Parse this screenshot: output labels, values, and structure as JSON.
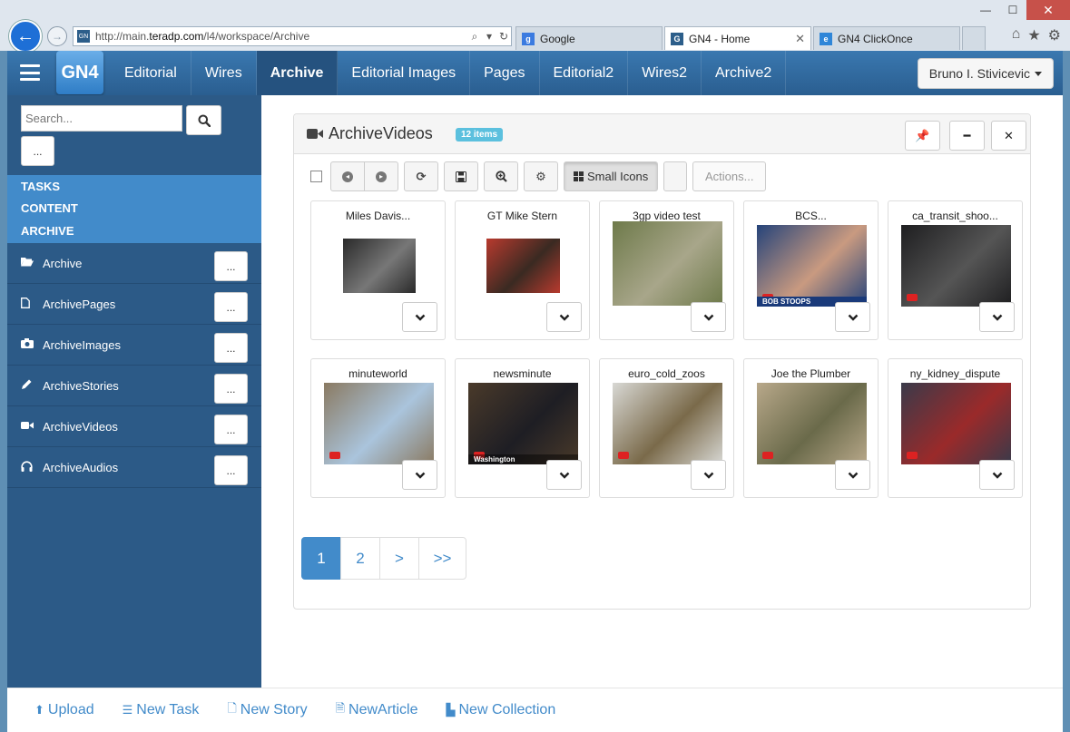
{
  "browser": {
    "url_prefix": "http://main.",
    "url_domain": "teradp.com",
    "url_suffix": "/l4/workspace/Archive",
    "tabs": [
      {
        "label": "Google",
        "active": false
      },
      {
        "label": "GN4 - Home",
        "active": true
      },
      {
        "label": "GN4 ClickOnce",
        "active": false
      }
    ],
    "win": {
      "minimize": "—",
      "maximize": "☐",
      "close": "✕"
    }
  },
  "header": {
    "logo": "GN4",
    "nav": [
      "Editorial",
      "Wires",
      "Archive",
      "Editorial Images",
      "Pages",
      "Editorial2",
      "Wires2",
      "Archive2"
    ],
    "active_nav": "Archive",
    "user": "Bruno I. Stivicevic"
  },
  "sidebar": {
    "search_placeholder": "Search...",
    "more_label": "...",
    "sections": [
      "TASKS",
      "CONTENT",
      "ARCHIVE"
    ],
    "items": [
      {
        "label": "Archive",
        "icon": "folder-open-icon"
      },
      {
        "label": "ArchivePages",
        "icon": "file-icon"
      },
      {
        "label": "ArchiveImages",
        "icon": "camera-icon"
      },
      {
        "label": "ArchiveStories",
        "icon": "pencil-icon"
      },
      {
        "label": "ArchiveVideos",
        "icon": "video-camera-icon"
      },
      {
        "label": "ArchiveAudios",
        "icon": "headphones-icon"
      }
    ]
  },
  "panel": {
    "title": "ArchiveVideos",
    "badge": "12 items",
    "toolbar": {
      "view_label": "Small Icons",
      "actions_label": "Actions..."
    },
    "items": [
      {
        "title": "Miles Davis...",
        "bg": "#2a2a2a",
        "accent": "#777"
      },
      {
        "title": "GT Mike Stern",
        "bg": "#b83a2e",
        "accent": "#3a2a22"
      },
      {
        "title": "3gp video test",
        "bg": "#6e7a4a",
        "accent": "#a8a68a"
      },
      {
        "title": "BCS...",
        "bg": "#25437a",
        "accent": "#c99a80",
        "caption": "BOB STOOPS"
      },
      {
        "title": "ca_transit_shoo...",
        "bg": "#1e1e20",
        "accent": "#555"
      },
      {
        "title": "minuteworld",
        "bg": "#8a7a62",
        "accent": "#aac4dc"
      },
      {
        "title": "newsminute",
        "bg": "#4a3a2a",
        "accent": "#1e1e24",
        "caption": "Washington"
      },
      {
        "title": "euro_cold_zoos",
        "bg": "#d8d8d4",
        "accent": "#7a6a4a"
      },
      {
        "title": "Joe the Plumber",
        "bg": "#b8a88a",
        "accent": "#6a6a4a"
      },
      {
        "title": "ny_kidney_dispute",
        "bg": "#3a3a4a",
        "accent": "#9a2a2a"
      }
    ],
    "pager": [
      "1",
      "2",
      ">",
      ">>"
    ],
    "active_page": "1"
  },
  "footer": {
    "links": [
      {
        "label": "Upload",
        "icon": "upload-icon",
        "glyph": "⬆"
      },
      {
        "label": "New Task",
        "icon": "list-icon",
        "glyph": "☰"
      },
      {
        "label": "New Story",
        "icon": "file-icon",
        "glyph": "🗋"
      },
      {
        "label": "NewArticle",
        "icon": "article-icon",
        "glyph": "🗎"
      },
      {
        "label": "New Collection",
        "icon": "collection-icon",
        "glyph": "▙"
      }
    ]
  }
}
